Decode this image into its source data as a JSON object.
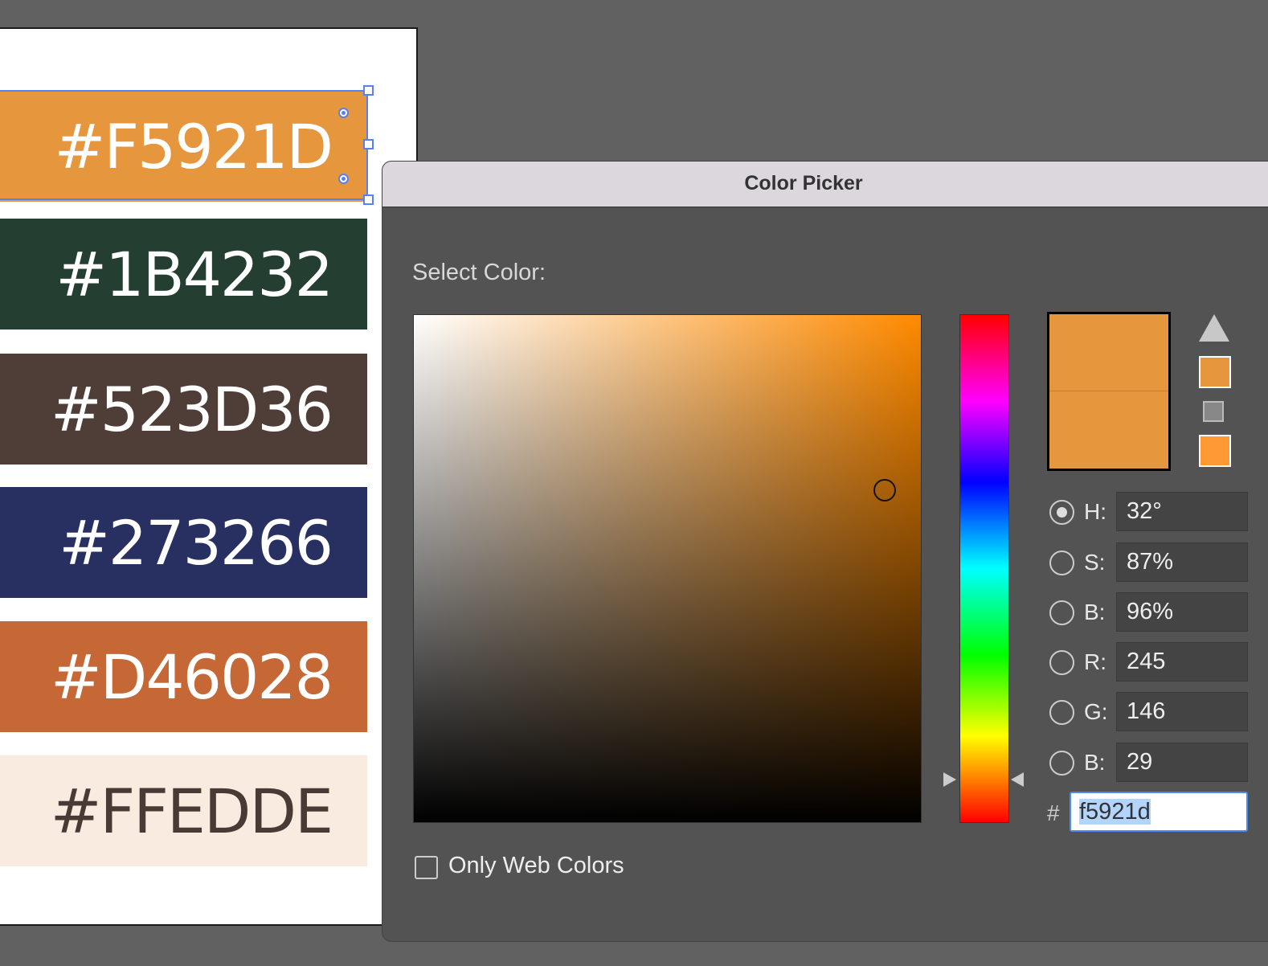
{
  "swatches": [
    {
      "label": "#F5921D",
      "bg": "#e6963c",
      "fg": "#ffffff"
    },
    {
      "label": "#1B4232",
      "bg": "#243f31",
      "fg": "#ffffff"
    },
    {
      "label": "#523D36",
      "bg": "#4f3d37",
      "fg": "#ffffff"
    },
    {
      "label": "#273266",
      "bg": "#283062",
      "fg": "#ffffff"
    },
    {
      "label": "#D46028",
      "bg": "#c66736",
      "fg": "#ffffff"
    },
    {
      "label": "#FFEDDE",
      "bg": "#f9ebe0",
      "fg": "#4a3a35"
    }
  ],
  "dialog": {
    "title": "Color Picker",
    "select_label": "Select Color:",
    "fields": [
      {
        "label": "H:",
        "value": "32°",
        "selected": true
      },
      {
        "label": "S:",
        "value": "87%"
      },
      {
        "label": "B:",
        "value": "96%"
      },
      {
        "label": "R:",
        "value": "245"
      },
      {
        "label": "G:",
        "value": "146"
      },
      {
        "label": "B:",
        "value": "29"
      }
    ],
    "hex_prefix": "#",
    "hex_value": "f5921d",
    "web_colors_label": "Only Web Colors"
  }
}
